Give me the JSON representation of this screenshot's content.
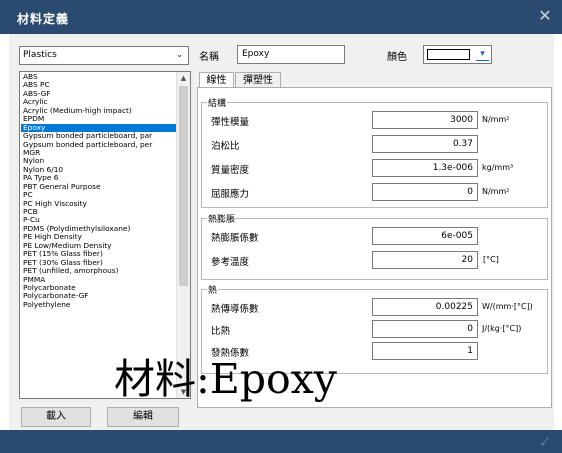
{
  "window": {
    "title": "材料定義",
    "close_glyph": "✕"
  },
  "category_select": {
    "value": "Plastics",
    "arrow": "⌄"
  },
  "materials": [
    "ABS",
    "ABS PC",
    "ABS-GF",
    "Acrylic",
    "Acrylic (Medium-high impact)",
    "EPDM",
    "Epoxy",
    "Gypsum bonded particleboard, par",
    "Gypsum bonded particleboard, per",
    "MGR",
    "Nylon",
    "Nylon 6/10",
    "PA Type 6",
    "PBT General Purpose",
    "PC",
    "PC High Viscosity",
    "PCB",
    "P-Cu",
    "PDMS (Polydimethylsiloxane)",
    "PE High Density",
    "PE Low/Medium Density",
    "PET (15% Glass fiber)",
    "PET (30% Glass fiber)",
    "PET (unfilled, amorphous)",
    "PMMA",
    "Polycarbonate",
    "Polycarbonate-GF",
    "Polyethylene"
  ],
  "selected_index": 6,
  "scroll": {
    "up": "▲",
    "down": "▼"
  },
  "buttons": {
    "load": "載入",
    "edit": "編輯"
  },
  "name": {
    "label": "名稱",
    "value": "Epoxy"
  },
  "color": {
    "label": "顏色",
    "arrow": "▾",
    "swatch": "#ffffff"
  },
  "tabs": [
    "線性",
    "彈塑性"
  ],
  "groups": {
    "structure": {
      "title": "結構",
      "rows": [
        {
          "label": "彈性模量",
          "value": "3000",
          "unit": "N/mm²"
        },
        {
          "label": "泊松比",
          "value": "0.37",
          "unit": ""
        },
        {
          "label": "質量密度",
          "value": "1.3e-006",
          "unit": "kg/mm³"
        },
        {
          "label": "屈服應力",
          "value": "0",
          "unit": "N/mm²"
        }
      ]
    },
    "thermal_expansion": {
      "title": "熱膨脹",
      "rows": [
        {
          "label": "熱膨脹係數",
          "value": "6e-005",
          "unit": ""
        },
        {
          "label": "參考溫度",
          "value": "20",
          "unit": "[°C]"
        }
      ]
    },
    "heat": {
      "title": "熱",
      "rows": [
        {
          "label": "熱傳導係數",
          "value": "0.00225",
          "unit": "W/(mm·[°C])"
        },
        {
          "label": "比熱",
          "value": "0",
          "unit": "J/(kg·[°C])"
        },
        {
          "label": "發熱係數",
          "value": "1",
          "unit": ""
        }
      ]
    }
  },
  "overlay_text": "材料:Epoxy",
  "footer": {
    "ok_glyph": "✓"
  },
  "colors": {
    "titlebar": "#2b4a6f",
    "selection": "#0078d7",
    "panel": "#f0f0f0"
  }
}
